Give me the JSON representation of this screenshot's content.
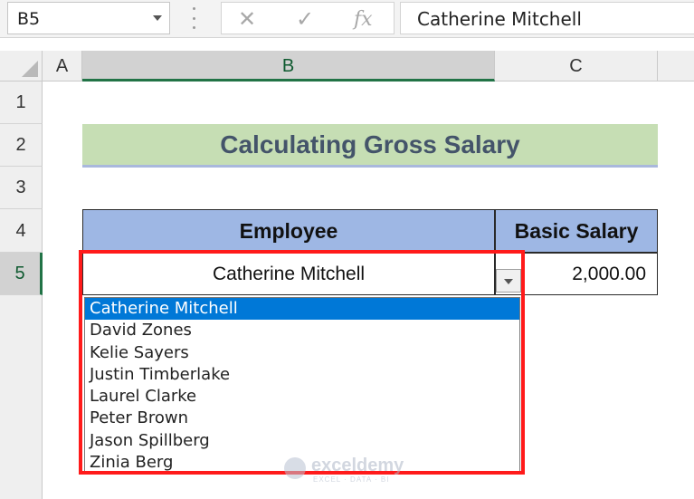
{
  "formula_bar": {
    "name_box": "B5",
    "cancel_icon": "✕",
    "enter_icon": "✓",
    "fx_label": "fx",
    "formula_text": "Catherine Mitchell"
  },
  "columns": [
    "A",
    "B",
    "C"
  ],
  "rows": [
    "1",
    "2",
    "3",
    "4",
    "5"
  ],
  "selected_cell": "B5",
  "sheet": {
    "title": "Calculating Gross Salary",
    "headers": [
      "Employee",
      "Basic Salary"
    ],
    "employee_value": "Catherine Mitchell",
    "basic_salary_value": "2,000.00"
  },
  "dropdown": {
    "options": [
      "Catherine Mitchell",
      "David Zones",
      "Kelie Sayers",
      "Justin Timberlake",
      "Laurel Clarke",
      "Peter Brown",
      "Jason Spillberg",
      "Zinia Berg"
    ],
    "selected_index": 0
  },
  "watermark": {
    "name": "exceldemy",
    "tagline": "EXCEL · DATA · BI"
  },
  "colors": {
    "title_fill": "#c6deb4",
    "header_fill": "#9eb7e4",
    "highlight_box": "#ff1a1a",
    "selection": "#0078d7",
    "excel_green": "#217346"
  }
}
